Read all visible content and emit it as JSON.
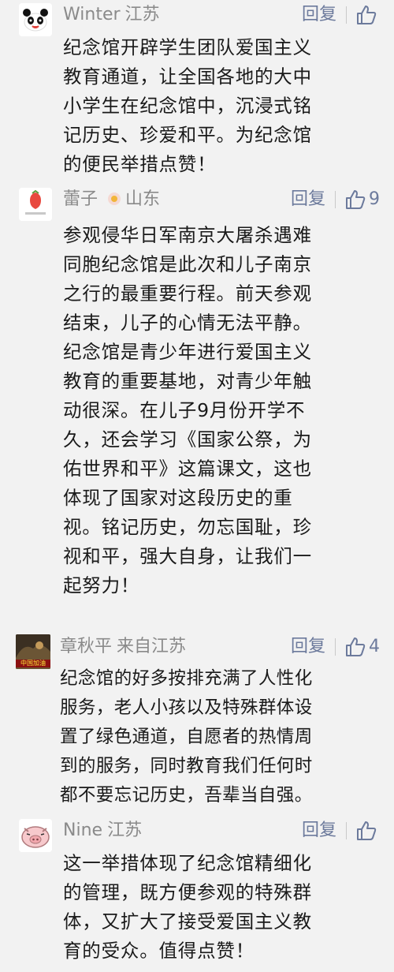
{
  "comments": [
    {
      "user": "Winter",
      "location": "江苏",
      "reply_label": "回复",
      "likes": "",
      "avatar_icon": "panda-avatar-icon",
      "lines": [
        "纪念馆开辟学生团队爱国主义",
        "教育通道，让全国各地的大中",
        "小学生在纪念馆中，沉浸式铭",
        "记历史、珍爱和平。为纪念馆",
        "的便民举措点赞！"
      ]
    },
    {
      "user": "蕾子",
      "location": "山东",
      "reply_label": "回复",
      "likes": "9",
      "avatar_icon": "strawberry-avatar-icon",
      "lines": [
        "参观侵华日军南京大屠杀遇难",
        "同胞纪念馆是此次和儿子南京",
        "之行的最重要行程。前天参观",
        "结束，儿子的心情无法平静。",
        "纪念馆是青少年进行爱国主义",
        "教育的重要基地，对青少年触",
        "动很深。在儿子9月份开学不",
        "久，还会学习《国家公祭，为",
        "佑世界和平》这篇课文，这也",
        "体现了国家对这段历史的重",
        "视。铭记历史，勿忘国耻，珍",
        "视和平，强大自身，让我们一",
        "起努力！"
      ]
    },
    {
      "user": "章秋平",
      "location": "来自江苏",
      "reply_label": "回复",
      "likes": "4",
      "avatar_icon": "photo-avatar-icon",
      "avatar_text": "中国加油",
      "lines": [
        "纪念馆的好多按排充满了人性化",
        "服务，老人小孩以及特殊群体设",
        "置了绿色通道，自愿者的热情周",
        "到的服务，同时教育我们任何时",
        "都不要忘记历史，吾辈当自强。"
      ]
    },
    {
      "user": "Nine",
      "location": "江苏",
      "reply_label": "回复",
      "likes": "",
      "avatar_icon": "pig-avatar-icon",
      "lines": [
        "这一举措体现了纪念馆精细化",
        "的管理，既方便参观的特殊群",
        "体，又扩大了接受爱国主义教",
        "育的受众。值得点赞！"
      ]
    }
  ],
  "colors": {
    "background": "#f2f2f2",
    "text": "#1a1a1a",
    "meta": "#8a8a8a",
    "action": "#6c7a9c"
  }
}
